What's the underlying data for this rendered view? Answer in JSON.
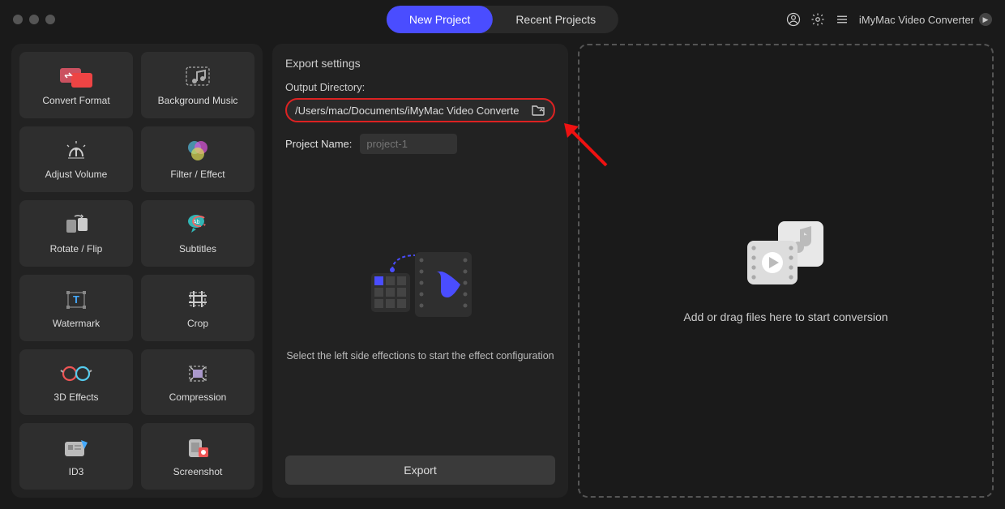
{
  "header": {
    "tabs": {
      "new": "New Project",
      "recent": "Recent Projects"
    },
    "app_name": "iMyMac Video Converter"
  },
  "sidebar": {
    "tools": [
      {
        "key": "convert-format",
        "label": "Convert Format"
      },
      {
        "key": "background-music",
        "label": "Background Music"
      },
      {
        "key": "adjust-volume",
        "label": "Adjust Volume"
      },
      {
        "key": "filter-effect",
        "label": "Filter / Effect"
      },
      {
        "key": "rotate-flip",
        "label": "Rotate / Flip"
      },
      {
        "key": "subtitles",
        "label": "Subtitles"
      },
      {
        "key": "watermark",
        "label": "Watermark"
      },
      {
        "key": "crop",
        "label": "Crop"
      },
      {
        "key": "3d-effects",
        "label": "3D Effects"
      },
      {
        "key": "compression",
        "label": "Compression"
      },
      {
        "key": "id3",
        "label": "ID3"
      },
      {
        "key": "screenshot",
        "label": "Screenshot"
      }
    ]
  },
  "export": {
    "title": "Export settings",
    "dir_label": "Output Directory:",
    "dir_value": "/Users/mac/Documents/iMyMac Video Converte",
    "name_label": "Project Name:",
    "name_placeholder": "project-1",
    "hint": "Select the left side effections to start the effect configuration",
    "button": "Export"
  },
  "drop": {
    "hint": "Add or drag files here to start conversion"
  }
}
